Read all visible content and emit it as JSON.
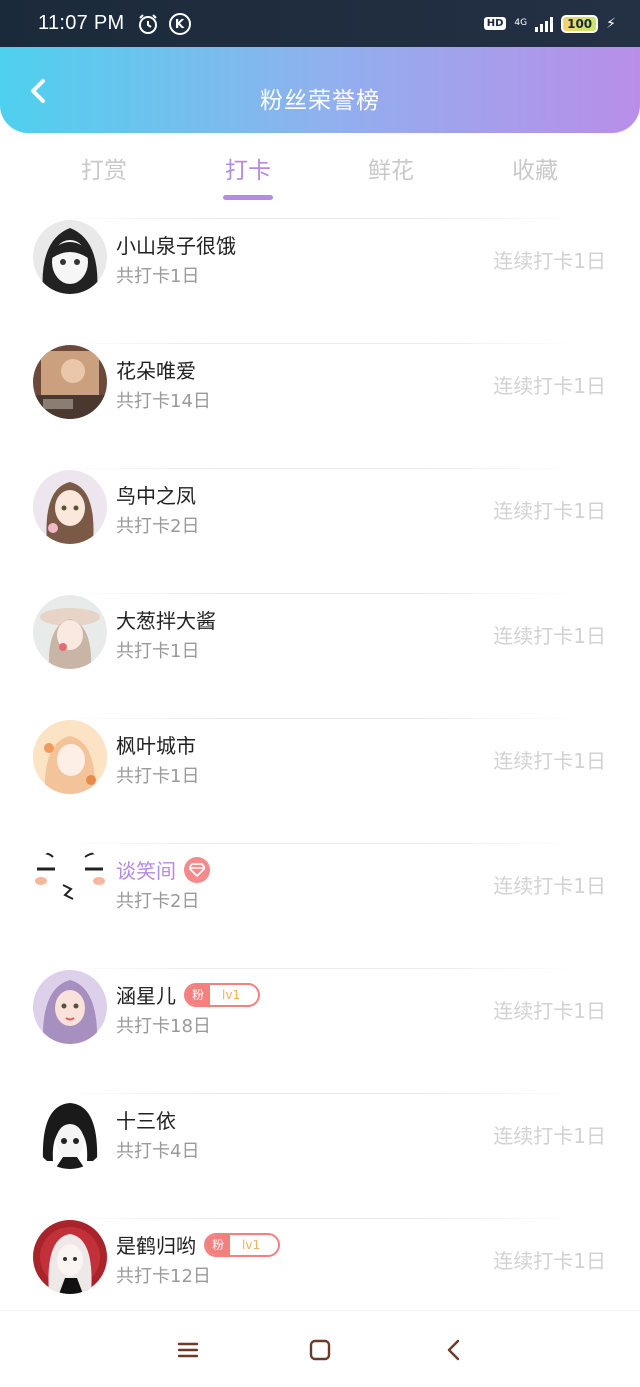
{
  "status_bar": {
    "time": "11:07 PM",
    "icons": [
      "alarm-icon",
      "k-app-icon"
    ],
    "k_glyph": "K",
    "hd": "HD",
    "network": "4G",
    "battery": "100"
  },
  "header": {
    "title": "粉丝荣誉榜",
    "back_icon": "chevron-left-icon",
    "gradient": [
      "#4ed1ee",
      "#b98ee9"
    ]
  },
  "tabs": [
    {
      "label": "打赏",
      "active": false
    },
    {
      "label": "打卡",
      "active": true
    },
    {
      "label": "鲜花",
      "active": false
    },
    {
      "label": "收藏",
      "active": false
    }
  ],
  "accent_color": "#b58ae2",
  "fans": [
    {
      "name": "小山泉子很饿",
      "total": "共打卡1日",
      "streak": "连续打卡1日"
    },
    {
      "name": "花朵唯爱",
      "total": "共打卡14日",
      "streak": "连续打卡1日"
    },
    {
      "name": "鸟中之凤",
      "total": "共打卡2日",
      "streak": "连续打卡1日"
    },
    {
      "name": "大葱拌大酱",
      "total": "共打卡1日",
      "streak": "连续打卡1日"
    },
    {
      "name": "枫叶城市",
      "total": "共打卡1日",
      "streak": "连续打卡1日"
    },
    {
      "name": "谈笑间",
      "total": "共打卡2日",
      "streak": "连续打卡1日",
      "badge": "diamond-icon"
    },
    {
      "name": "涵星儿",
      "total": "共打卡18日",
      "streak": "连续打卡1日",
      "fan_badge": {
        "fan": "粉",
        "level": "lv1"
      }
    },
    {
      "name": "十三依",
      "total": "共打卡4日",
      "streak": "连续打卡1日"
    },
    {
      "name": "是鹤归哟",
      "total": "共打卡12日",
      "streak": "连续打卡1日",
      "fan_badge": {
        "fan": "粉",
        "level": "lv1"
      }
    }
  ],
  "bottom_nav": [
    "menu-icon",
    "home-square-icon",
    "back-triangle-icon"
  ]
}
